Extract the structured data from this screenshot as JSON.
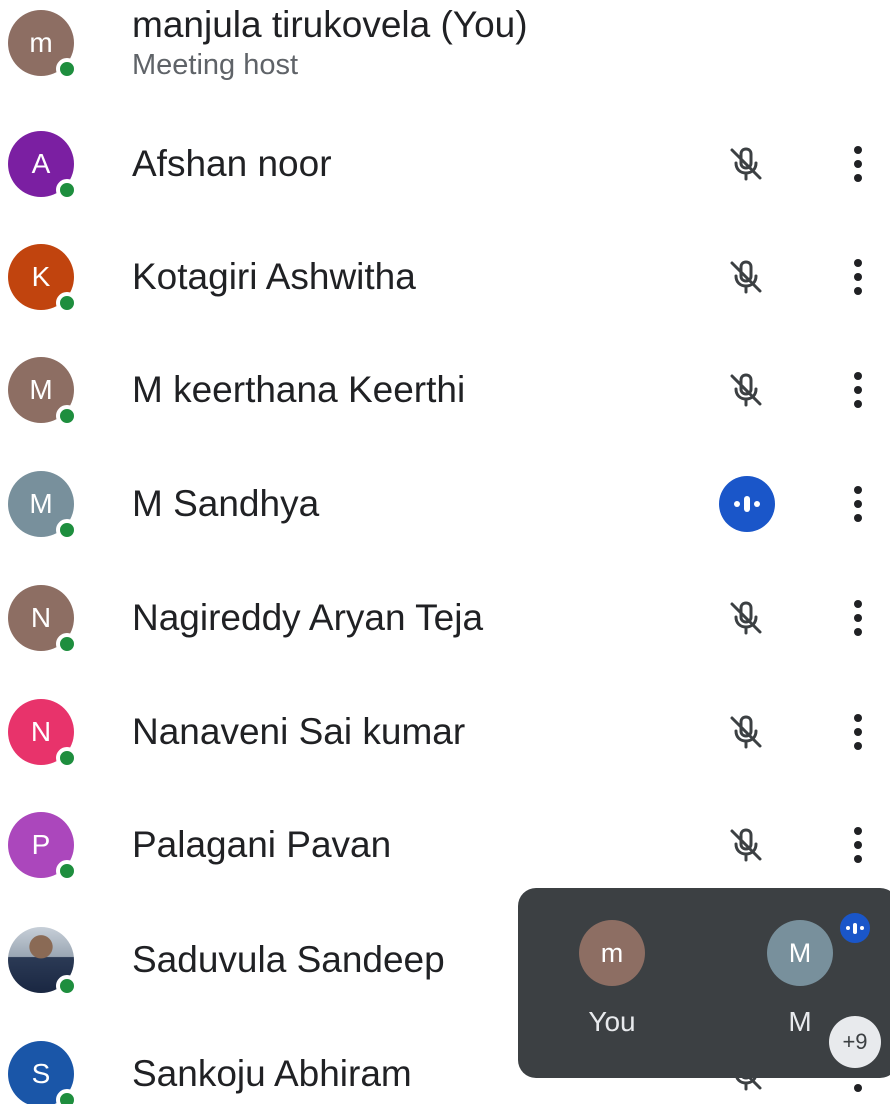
{
  "participants": [
    {
      "initial": "m",
      "name": "manjula tirukovela (You)",
      "subtitle": "Meeting host",
      "avatar_color": "#8d6e63",
      "status": "none"
    },
    {
      "initial": "A",
      "name": "Afshan noor",
      "avatar_color": "#7b1fa2",
      "status": "muted"
    },
    {
      "initial": "K",
      "name": "Kotagiri Ashwitha",
      "avatar_color": "#c1440e",
      "status": "muted"
    },
    {
      "initial": "M",
      "name": "M keerthana Keerthi",
      "avatar_color": "#8d6e63",
      "status": "muted"
    },
    {
      "initial": "M",
      "name": "M Sandhya",
      "avatar_color": "#78909c",
      "status": "speaking"
    },
    {
      "initial": "N",
      "name": "Nagireddy Aryan Teja",
      "avatar_color": "#8d6e63",
      "status": "muted"
    },
    {
      "initial": "N",
      "name": "Nanaveni Sai kumar",
      "avatar_color": "#e8336b",
      "status": "muted"
    },
    {
      "initial": "P",
      "name": "Palagani Pavan",
      "avatar_color": "#ab47bc",
      "status": "muted"
    },
    {
      "initial": "",
      "name": "Saduvula Sandeep",
      "avatar_color": "photo",
      "status": "muted"
    },
    {
      "initial": "S",
      "name": "Sankoju Abhiram",
      "avatar_color": "#1a56a8",
      "status": "muted"
    }
  ],
  "icons": {
    "mic_off": "mic-off-icon",
    "speaking": "audio-level-icon",
    "more": "more-vert-icon",
    "online": "online-status-dot"
  },
  "colors": {
    "online": "#1e8e3e",
    "speaking": "#1a56c9",
    "pip_background": "#3c4043"
  },
  "pip": {
    "tiles": [
      {
        "initial": "m",
        "label": "You",
        "avatar_color": "#8d6e63"
      },
      {
        "initial": "M",
        "label": "M",
        "avatar_color": "#78909c"
      }
    ],
    "overflow_count": "+9"
  }
}
